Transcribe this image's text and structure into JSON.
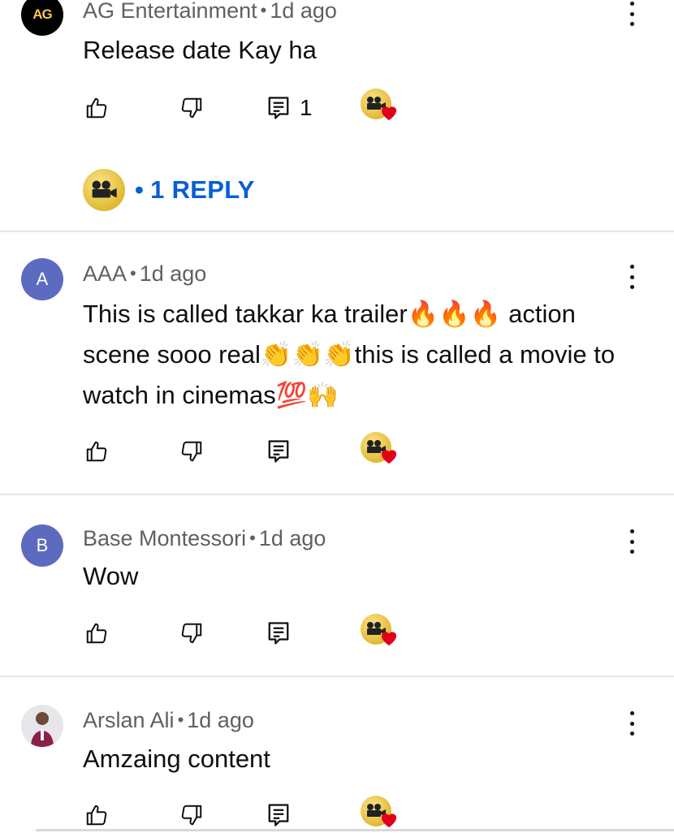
{
  "comments": [
    {
      "author": "AG Entertainment",
      "time": "1d ago",
      "text": "Release date Kay ha",
      "avatar_text": "AG",
      "reply_count": "1",
      "replies_link": "1 REPLY"
    },
    {
      "author": "AAA",
      "time": "1d ago",
      "text": "This is called takkar ka trailer🔥🔥🔥 action scene sooo real👏👏👏this is called a movie to watch in cinemas💯🙌",
      "avatar_text": "A"
    },
    {
      "author": "Base Montessori",
      "time": "1d ago",
      "text": "Wow",
      "avatar_text": "B"
    },
    {
      "author": "Arslan Ali",
      "time": "1d ago",
      "text": "Amzaing content",
      "avatar_text": ""
    }
  ],
  "separator": "•",
  "icons": {
    "like": "thumbs-up-icon",
    "dislike": "thumbs-down-icon",
    "reply": "comment-icon",
    "more": "more-vert-icon",
    "creator_heart": "creator-heart-icon"
  },
  "colors": {
    "link_blue": "#065fd4",
    "avatar_purple": "#5c6bc0",
    "meta_gray": "#606060",
    "heart_red": "#e0001b"
  }
}
